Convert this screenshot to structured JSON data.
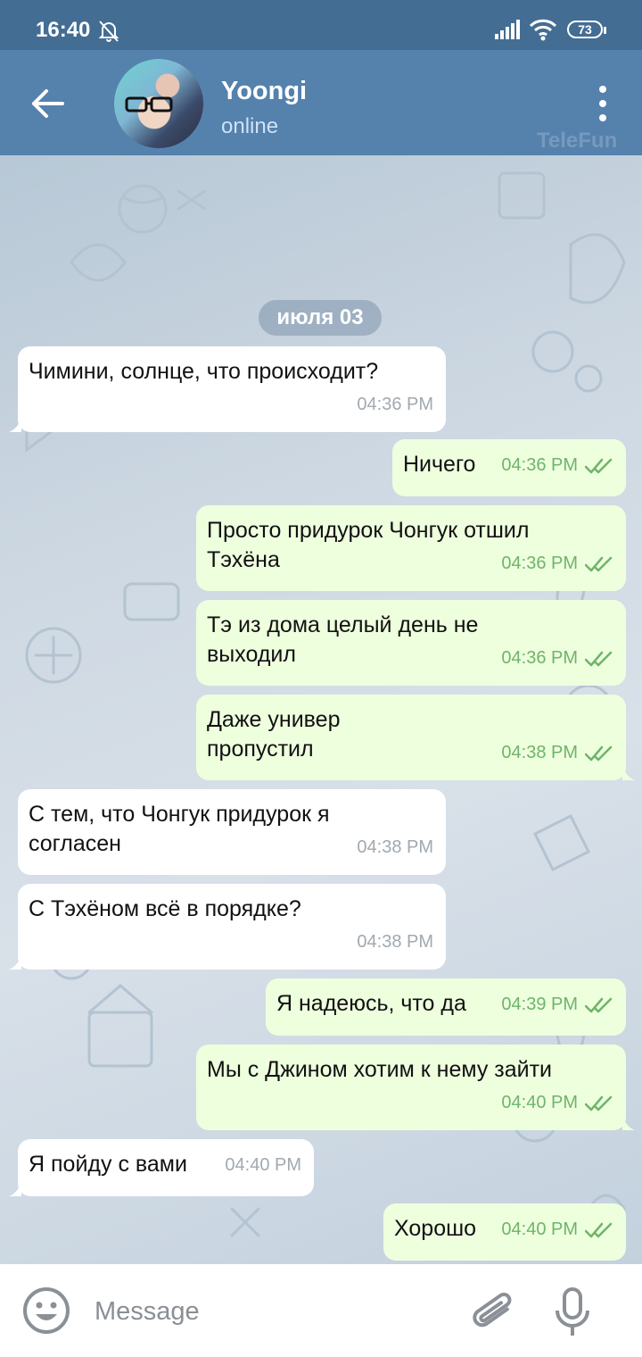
{
  "status_bar": {
    "time": "16:40",
    "battery": "73",
    "icons": [
      "bell-off-icon",
      "signal-icon",
      "wifi-icon",
      "battery-icon"
    ]
  },
  "header": {
    "name": "Yoongi",
    "status": "online",
    "watermark": "TeleFun",
    "icons": [
      "back-arrow-icon",
      "avatar",
      "more-vert-icon"
    ]
  },
  "date_separator": "июля 03",
  "messages": [
    {
      "dir": "in",
      "text": "Чимини, солнце, что происходит?",
      "time": "04:36 PM"
    },
    {
      "dir": "out",
      "text": "Ничего",
      "time": "04:36 PM"
    },
    {
      "dir": "out",
      "text": "Просто придурок Чонгук отшил Тэхёна",
      "time": "04:36 PM"
    },
    {
      "dir": "out",
      "text": "Тэ из дома целый день не выходил",
      "time": "04:36 PM"
    },
    {
      "dir": "out",
      "text": "Даже универ пропустил",
      "time": "04:38 PM"
    },
    {
      "dir": "in",
      "text": "С тем, что Чонгук придурок я согласен",
      "time": "04:38 PM"
    },
    {
      "dir": "in",
      "text": "С Тэхёном всё в порядке?",
      "time": "04:38 PM"
    },
    {
      "dir": "out",
      "text": "Я надеюсь, что да",
      "time": "04:39 PM"
    },
    {
      "dir": "out",
      "text": "Мы с Джином хотим к нему зайти",
      "time": "04:40 PM"
    },
    {
      "dir": "in",
      "text": "Я пойду с вами",
      "time": "04:40 PM"
    },
    {
      "dir": "out",
      "text": "Хорошо",
      "time": "04:40 PM"
    }
  ],
  "input_bar": {
    "placeholder": "Message",
    "icons": [
      "emoji-icon",
      "attach-icon",
      "mic-icon"
    ]
  },
  "colors": {
    "status_bar": "#446d93",
    "header": "#5581ad",
    "outgoing_bubble": "#eeffde",
    "incoming_bubble": "#ffffff",
    "read_ticks": "#6fb46a"
  }
}
